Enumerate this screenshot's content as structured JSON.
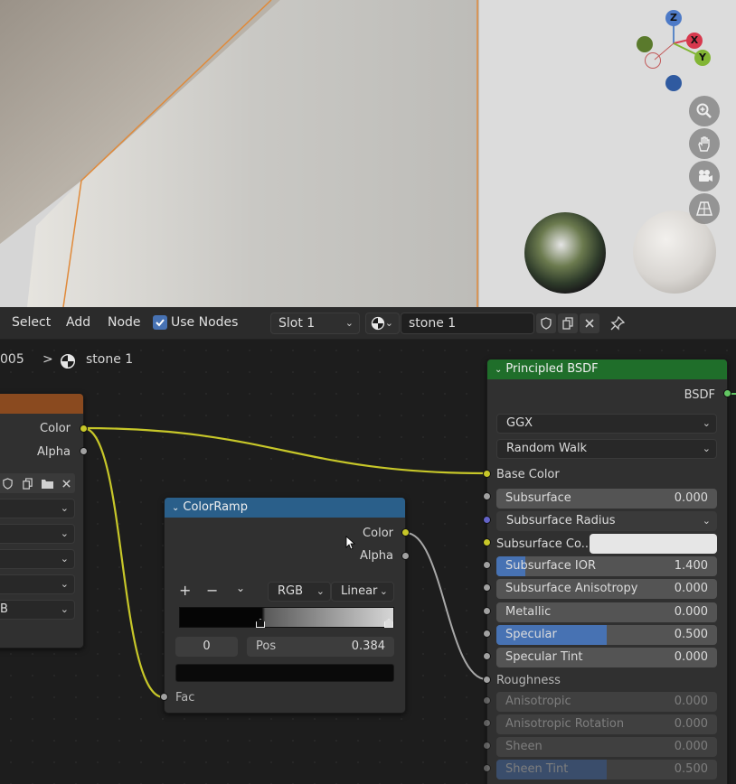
{
  "toolbar": {
    "menu_select": "Select",
    "menu_add": "Add",
    "menu_node": "Node",
    "use_nodes_label": "Use Nodes",
    "slot_label": "Slot 1",
    "material_name": "stone 1"
  },
  "breadcrumb": {
    "object": "005",
    "separator": ">",
    "material": "stone 1"
  },
  "left_node": {
    "outputs": [
      "Color",
      "Alpha"
    ],
    "last_field": "B"
  },
  "colorramp": {
    "title": "ColorRamp",
    "output_color": "Color",
    "output_alpha": "Alpha",
    "add": "+",
    "remove": "−",
    "color_mode": "RGB",
    "interpolation": "Linear",
    "stop_index": "0",
    "pos_label": "Pos",
    "pos_value": "0.384",
    "input_fac": "Fac"
  },
  "bsdf": {
    "title": "Principled BSDF",
    "output": "BSDF",
    "distribution": "GGX",
    "subsurface_method": "Random Walk",
    "base_color": "Base Color",
    "roughness": "Roughness",
    "fields": [
      {
        "label": "Subsurface",
        "value": "0.000",
        "fill": 0.0
      },
      {
        "label": "Subsurface Radius",
        "value": "",
        "fill": 0.0
      },
      {
        "label": "Subsurface Co...",
        "value": "",
        "fill": 0.0
      },
      {
        "label": "Subsurface IOR",
        "value": "1.400",
        "fill": 0.13
      },
      {
        "label": "Subsurface Anisotropy",
        "value": "0.000",
        "fill": 0.0
      },
      {
        "label": "Metallic",
        "value": "0.000",
        "fill": 0.0
      },
      {
        "label": "Specular",
        "value": "0.500",
        "fill": 0.5
      },
      {
        "label": "Specular Tint",
        "value": "0.000",
        "fill": 0.0
      },
      {
        "label": "Anisotropic",
        "value": "0.000",
        "fill": 0.0
      },
      {
        "label": "Anisotropic Rotation",
        "value": "0.000",
        "fill": 0.0
      },
      {
        "label": "Sheen",
        "value": "0.000",
        "fill": 0.0
      },
      {
        "label": "Sheen Tint",
        "value": "0.500",
        "fill": 0.5
      }
    ]
  },
  "gizmo": {
    "z": "Z",
    "x": "X",
    "y": "Y"
  },
  "colors": {
    "accent_blue": "#4772b3",
    "socket_yellow": "#c7c729",
    "socket_gray": "#a1a1a1",
    "socket_purple": "#6363c7",
    "socket_green": "#63c763",
    "bsdf_header": "#1f6e2a",
    "ramp_header": "#2a5f8a",
    "tex_header": "#8a4a1f"
  }
}
